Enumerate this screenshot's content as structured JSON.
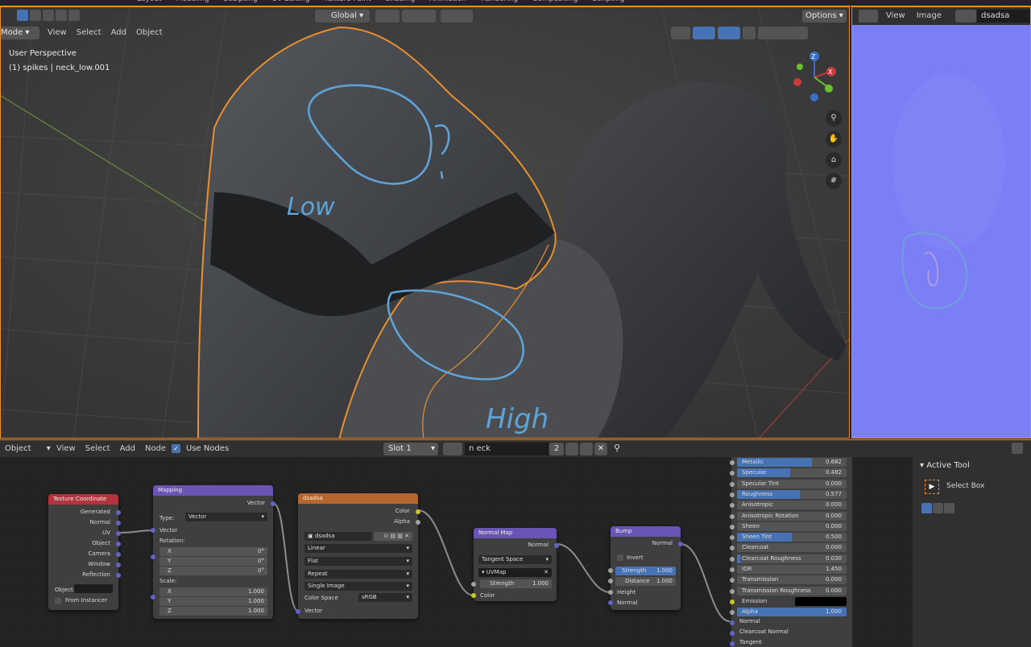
{
  "topbar": {
    "tabs": [
      "Layout",
      "Modeling",
      "Sculpting",
      "UV Editing",
      "Texture Paint",
      "Shading",
      "Animation",
      "Rendering",
      "Compositing",
      "Scripting"
    ]
  },
  "viewport": {
    "mode": "Mode",
    "menus": [
      "View",
      "Select",
      "Add",
      "Object"
    ],
    "transform_orientation": "Global",
    "options": "Options",
    "perspective": "User Perspective",
    "object_info": "(1) spikes | neck_low.001",
    "annot_low": "Low",
    "annot_high": "High",
    "gizmo": {
      "z": "Z",
      "x": "X",
      "y": "Y"
    }
  },
  "image_editor": {
    "menus": [
      "View",
      "Image"
    ],
    "image_name": "dsadsa"
  },
  "node_editor": {
    "object_menu": "Object",
    "menus": [
      "View",
      "Select",
      "Add",
      "Node"
    ],
    "use_nodes": "Use Nodes",
    "slot": "Slot 1",
    "material": "n eck",
    "users": "2"
  },
  "nodes": {
    "texcoord": {
      "title": "Texture Coordinate",
      "outputs": [
        "Generated",
        "Normal",
        "UV",
        "Object",
        "Camera",
        "Window",
        "Reflection"
      ],
      "object_label": "Object:",
      "from_instancer": "From Instancer"
    },
    "mapping": {
      "title": "Mapping",
      "out": "Vector",
      "type_label": "Type:",
      "type_value": "Vector",
      "in_vector": "Vector",
      "rotation": "Rotation:",
      "scale": "Scale:",
      "rot": [
        {
          "a": "X",
          "v": "0°"
        },
        {
          "a": "Y",
          "v": "0°"
        },
        {
          "a": "Z",
          "v": "0°"
        }
      ],
      "scl": [
        {
          "a": "X",
          "v": "1.000"
        },
        {
          "a": "Y",
          "v": "1.000"
        },
        {
          "a": "Z",
          "v": "1.000"
        }
      ]
    },
    "image": {
      "title": "dsadsa",
      "out_color": "Color",
      "out_alpha": "Alpha",
      "image_name": "dsadsa",
      "interp": "Linear",
      "proj": "Flat",
      "ext": "Repeat",
      "source": "Single Image",
      "cs_label": "Color Space",
      "cs_value": "sRGB",
      "in_vector": "Vector"
    },
    "normalmap": {
      "title": "Normal Map",
      "out": "Normal",
      "space": "Tangent Space",
      "uvmap": "UVMap",
      "strength_label": "Strength",
      "strength": "1.000",
      "in_color": "Color"
    },
    "bump": {
      "title": "Bump",
      "out": "Normal",
      "invert": "Invert",
      "strength_label": "Strength",
      "strength": "1.000",
      "distance_label": "Distance",
      "distance": "1.000",
      "height": "Height",
      "normal": "Normal"
    }
  },
  "bsdf": [
    {
      "l": "Metallic",
      "v": "0.682",
      "f": 0.682,
      "hl": false
    },
    {
      "l": "Specular",
      "v": "0.482",
      "f": 0.482,
      "hl": false
    },
    {
      "l": "Specular Tint",
      "v": "0.000",
      "f": 0,
      "hl": false
    },
    {
      "l": "Roughness",
      "v": "0.577",
      "f": 0.577,
      "hl": false
    },
    {
      "l": "Anisotropic",
      "v": "0.000",
      "f": 0,
      "hl": false
    },
    {
      "l": "Anisotropic Rotation",
      "v": "0.000",
      "f": 0,
      "hl": false
    },
    {
      "l": "Sheen",
      "v": "0.000",
      "f": 0,
      "hl": false
    },
    {
      "l": "Sheen Tint",
      "v": "0.500",
      "f": 0.5,
      "hl": false
    },
    {
      "l": "Clearcoat",
      "v": "0.000",
      "f": 0,
      "hl": false
    },
    {
      "l": "Clearcoat Roughness",
      "v": "0.030",
      "f": 0.03,
      "hl": false
    },
    {
      "l": "IOR",
      "v": "1.450",
      "f": 0,
      "hl": false
    },
    {
      "l": "Transmission",
      "v": "0.000",
      "f": 0,
      "hl": false
    },
    {
      "l": "Transmission Roughness",
      "v": "0.000",
      "f": 0,
      "hl": false
    },
    {
      "l": "Emission",
      "v": "",
      "f": 0,
      "hl": false
    },
    {
      "l": "Alpha",
      "v": "1.000",
      "f": 1,
      "hl": true
    }
  ],
  "bsdf_inputs": [
    "Normal",
    "Clearcoat Normal",
    "Tangent"
  ],
  "tool_panel": {
    "title": "Active Tool",
    "tool": "Select Box"
  },
  "colors": {
    "accent": "#e8902f",
    "select": "#4772b3",
    "vector_socket": "#6363c7",
    "color_socket": "#c7c729"
  }
}
